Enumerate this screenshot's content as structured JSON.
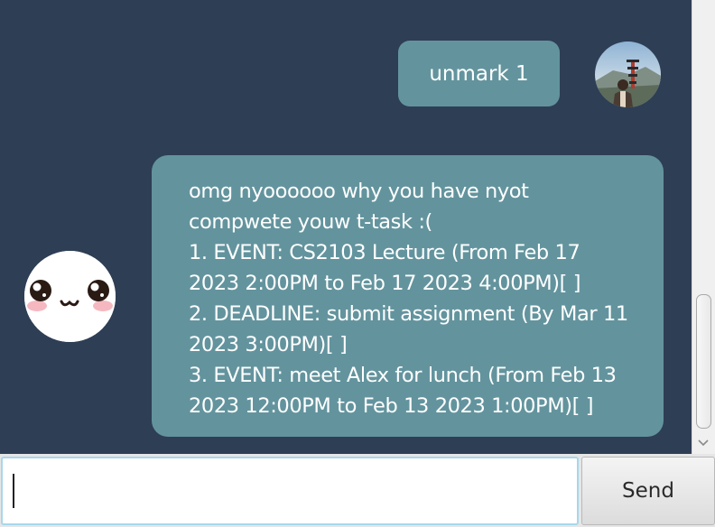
{
  "conversation": {
    "user_message": "unmark 1",
    "bot_message_lines": [
      "omg nyoooooo why you have nyot",
      "compwete youw t-task :(",
      "1. EVENT: CS2103 Lecture (From Feb 17",
      "2023 2:00PM to Feb 17 2023 4:00PM)[ ]",
      "2. DEADLINE: submit assignment (By Mar 11",
      "2023 3:00PM)[ ]",
      "3. EVENT: meet Alex for lunch (From Feb 13",
      "2023 12:00PM to Feb 13 2023 1:00PM)[ ]"
    ]
  },
  "input": {
    "value": "",
    "send_label": "Send"
  },
  "colors": {
    "chat_background": "#2e3e55",
    "bubble": "#63949e",
    "input_focus_border": "#a7d7ec"
  }
}
